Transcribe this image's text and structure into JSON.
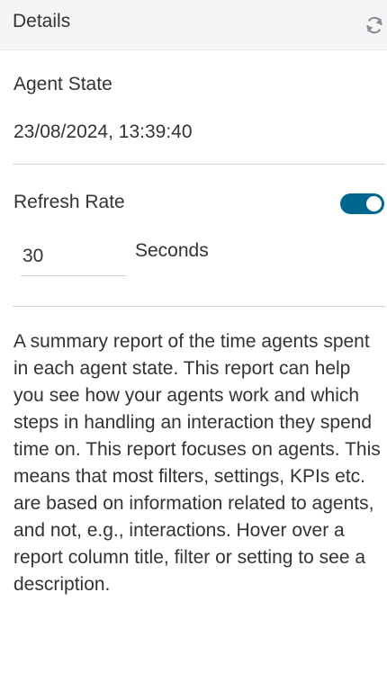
{
  "header": {
    "title": "Details",
    "refresh_icon": "refresh-icon"
  },
  "agent_state": {
    "title": "Agent State",
    "timestamp": "23/08/2024, 13:39:40"
  },
  "refresh_rate": {
    "label": "Refresh Rate",
    "enabled": true,
    "value": "30",
    "unit_label": "Seconds",
    "toggle_color": "#00658f"
  },
  "description": "A summary report of the time agents spent in each agent state. This report can help you see how your agents work and which steps in handling an interaction they spend time on. This report focuses on agents. This means that most filters, settings, KPIs etc. are based on information related to agents, and not, e.g., interactions. Hover over a report column title, filter or setting to see a description."
}
